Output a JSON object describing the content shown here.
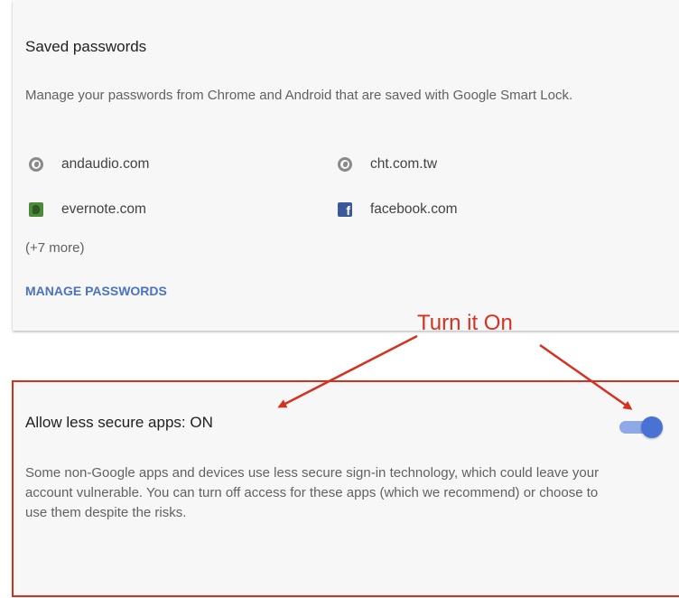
{
  "saved_passwords": {
    "title": "Saved passwords",
    "description": "Manage your passwords from Chrome and Android that are saved with Google Smart Lock.",
    "sites": [
      {
        "name": "andaudio.com",
        "icon": "globe-icon"
      },
      {
        "name": "cht.com.tw",
        "icon": "globe-icon"
      },
      {
        "name": "evernote.com",
        "icon": "evernote-icon"
      },
      {
        "name": "facebook.com",
        "icon": "facebook-icon"
      }
    ],
    "more": "(+7 more)",
    "manage_label": "MANAGE PASSWORDS"
  },
  "annotation": {
    "text": "Turn it On",
    "color": "#d7301f"
  },
  "less_secure_apps": {
    "title": "Allow less secure apps: ON",
    "toggle_on": true,
    "description": "Some non-Google apps and devices use less secure sign-in technology, which could leave your account vulnerable. You can turn off access for these apps (which we recommend) or choose to use them despite the risks."
  },
  "colors": {
    "accent": "#4a72d4",
    "link": "#4a72c4",
    "annotation": "#d7301f"
  }
}
